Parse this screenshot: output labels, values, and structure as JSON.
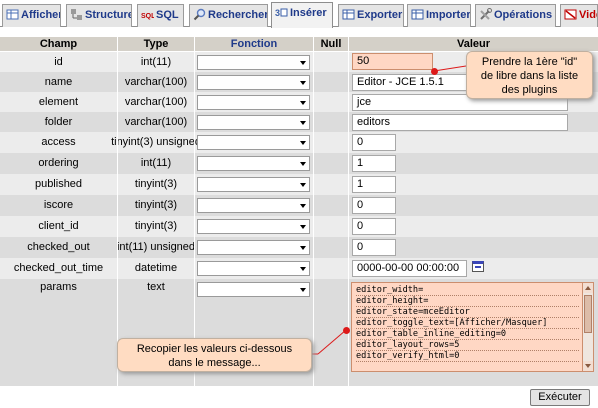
{
  "tabs": [
    {
      "label": "Afficher",
      "icon": "browse-table-icon",
      "color": "#4a6fb5",
      "active": false
    },
    {
      "label": "Structure",
      "icon": "structure-icon",
      "color": "#6a6a6a",
      "active": false
    },
    {
      "label": "SQL",
      "icon": "sql-icon",
      "color": "#c00000",
      "active": false
    },
    {
      "label": "Rechercher",
      "icon": "search-icon",
      "color": "#5a7abf",
      "active": false
    },
    {
      "label": "Insérer",
      "icon": "insert-row-icon",
      "color": "#3a5fa8",
      "active": true
    },
    {
      "label": "Exporter",
      "icon": "export-icon",
      "color": "#3a5fa8",
      "active": false
    },
    {
      "label": "Importer",
      "icon": "import-icon",
      "color": "#3a5fa8",
      "active": false
    },
    {
      "label": "Opérations",
      "icon": "tools-icon",
      "color": "#707070",
      "active": false
    },
    {
      "label": "Vide",
      "icon": "empty-table-icon",
      "color": "#c00000",
      "active": false
    }
  ],
  "headers": {
    "field": "Champ",
    "type": "Type",
    "function": "Fonction",
    "null": "Null",
    "value": "Valeur"
  },
  "rows": [
    {
      "field": "id",
      "type": "int(11)",
      "value": "50"
    },
    {
      "field": "name",
      "type": "varchar(100)",
      "value": "Editor - JCE 1.5.1"
    },
    {
      "field": "element",
      "type": "varchar(100)",
      "value": "jce"
    },
    {
      "field": "folder",
      "type": "varchar(100)",
      "value": "editors"
    },
    {
      "field": "access",
      "type": "tinyint(3) unsigned",
      "value": "0"
    },
    {
      "field": "ordering",
      "type": "int(11)",
      "value": "1"
    },
    {
      "field": "published",
      "type": "tinyint(3)",
      "value": "1"
    },
    {
      "field": "iscore",
      "type": "tinyint(3)",
      "value": "0"
    },
    {
      "field": "client_id",
      "type": "tinyint(3)",
      "value": "0"
    },
    {
      "field": "checked_out",
      "type": "int(11) unsigned",
      "value": "0"
    },
    {
      "field": "checked_out_time",
      "type": "datetime",
      "value": "0000-00-00 00:00:00"
    },
    {
      "field": "params",
      "type": "text",
      "value": ""
    }
  ],
  "params_lines": [
    "editor_width=",
    "editor_height=",
    "editor_state=mceEditor",
    "editor_toggle_text=[Afficher/Masquer]",
    "editor_table_inline_editing=0",
    "editor_layout_rows=5",
    "editor_verify_html=0"
  ],
  "callouts": {
    "top": [
      "Prendre la 1ère \"id\"",
      "de libre dans la liste",
      "des plugins"
    ],
    "bottom": [
      "Recopier les valeurs ci-dessous",
      "dans le message..."
    ]
  },
  "colors": {
    "highlight": "#ffd7c4",
    "callout": "#ffdcc2",
    "marker": "#dd1a1a",
    "header_bg": "#d4d0c8"
  },
  "execute_label": "Exécuter"
}
